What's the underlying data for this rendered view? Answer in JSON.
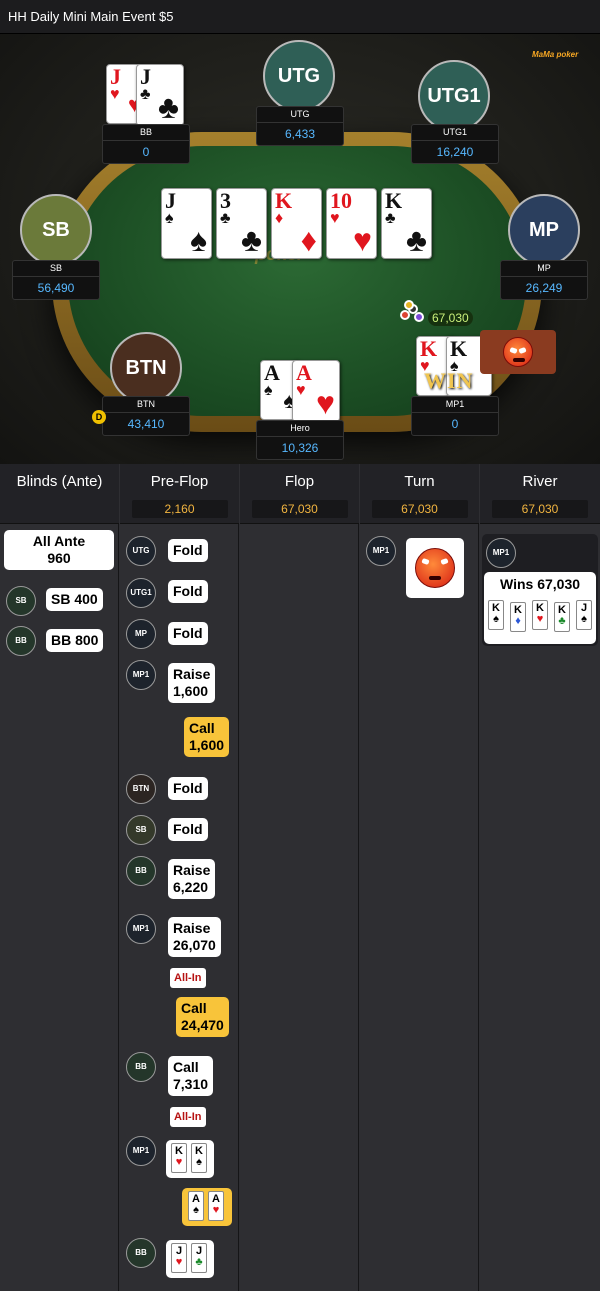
{
  "title": "HH  Daily Mini Main Event $5",
  "brand": "MaMa poker",
  "watermark": "poker",
  "seats": {
    "utg": {
      "avatar": "UTG",
      "name": "UTG",
      "stack": "6,433"
    },
    "utg1": {
      "avatar": "UTG1",
      "name": "UTG1",
      "stack": "16,240"
    },
    "mp": {
      "avatar": "MP",
      "name": "MP",
      "stack": "26,249"
    },
    "mp1": {
      "name": "MP1",
      "stack": "0"
    },
    "hero": {
      "name": "Hero",
      "stack": "10,326"
    },
    "btn": {
      "avatar": "BTN",
      "name": "BTN",
      "stack": "43,410"
    },
    "sb": {
      "avatar": "SB",
      "name": "SB",
      "stack": "56,490"
    },
    "bb": {
      "name": "BB",
      "stack": "0"
    }
  },
  "dealer_button": "D",
  "board": [
    {
      "rank": "J",
      "suit": "♠",
      "color": "black"
    },
    {
      "rank": "3",
      "suit": "♣",
      "color": "black"
    },
    {
      "rank": "K",
      "suit": "♦",
      "color": "red"
    },
    {
      "rank": "10",
      "suit": "♥",
      "color": "red"
    },
    {
      "rank": "K",
      "suit": "♣",
      "color": "black"
    }
  ],
  "hole_cards": {
    "bb": [
      {
        "rank": "J",
        "suit": "♥"
      },
      {
        "rank": "J",
        "suit": "♣"
      }
    ],
    "hero": [
      {
        "rank": "A",
        "suit": "♠"
      },
      {
        "rank": "A",
        "suit": "♥"
      }
    ],
    "mp1": [
      {
        "rank": "K",
        "suit": "♥"
      },
      {
        "rank": "K",
        "suit": "♠"
      }
    ]
  },
  "pot_amount": "67,030",
  "win_banner": "WIN",
  "history": {
    "columns": [
      {
        "title": "Blinds (Ante)",
        "pot": ""
      },
      {
        "title": "Pre-Flop",
        "pot": "2,160"
      },
      {
        "title": "Flop",
        "pot": "67,030"
      },
      {
        "title": "Turn",
        "pot": "67,030"
      },
      {
        "title": "River",
        "pot": "67,030"
      }
    ],
    "blinds": {
      "all_ante_line1": "All Ante",
      "all_ante_line2": "960",
      "sb_pos": "SB",
      "sb_amount": "SB  400",
      "bb_pos": "BB",
      "bb_amount": "BB  800"
    },
    "preflop": [
      {
        "pos": "UTG",
        "l1": "Fold",
        "l2": ""
      },
      {
        "pos": "UTG1",
        "l1": "Fold",
        "l2": ""
      },
      {
        "pos": "MP",
        "l1": "Fold",
        "l2": ""
      },
      {
        "pos": "MP1",
        "l1": "Raise",
        "l2": "1,600"
      },
      {
        "pos": "",
        "l1": "Call",
        "l2": "1,600"
      },
      {
        "pos": "BTN",
        "l1": "Fold",
        "l2": ""
      },
      {
        "pos": "SB",
        "l1": "Fold",
        "l2": ""
      },
      {
        "pos": "BB",
        "l1": "Raise",
        "l2": "6,220"
      },
      {
        "pos": "MP1",
        "l1": "Raise",
        "l2": "26,070"
      },
      {
        "pos": "",
        "l1": "Call",
        "l2": "24,470"
      },
      {
        "pos": "BB",
        "l1": "Call",
        "l2": "7,310"
      }
    ],
    "allin_label": "All-In",
    "showdown": {
      "mp1_pos": "MP1",
      "bb_pos": "BB"
    },
    "turn_pos": "MP1",
    "river": {
      "pos": "MP1",
      "wins": "Wins 67,030",
      "best_hand": [
        {
          "rank": "K",
          "suit": "♠",
          "color": "black"
        },
        {
          "rank": "K",
          "suit": "♦",
          "color": "blue"
        },
        {
          "rank": "K",
          "suit": "♥",
          "color": "red"
        },
        {
          "rank": "K",
          "suit": "♣",
          "color": "green"
        },
        {
          "rank": "J",
          "suit": "♠",
          "color": "black"
        }
      ]
    }
  },
  "colors": {
    "stack": "#57b8ff",
    "pot": "#f2b540",
    "call": "#f8c43a",
    "allin": "#b61212",
    "felt": "#1c4e24"
  }
}
